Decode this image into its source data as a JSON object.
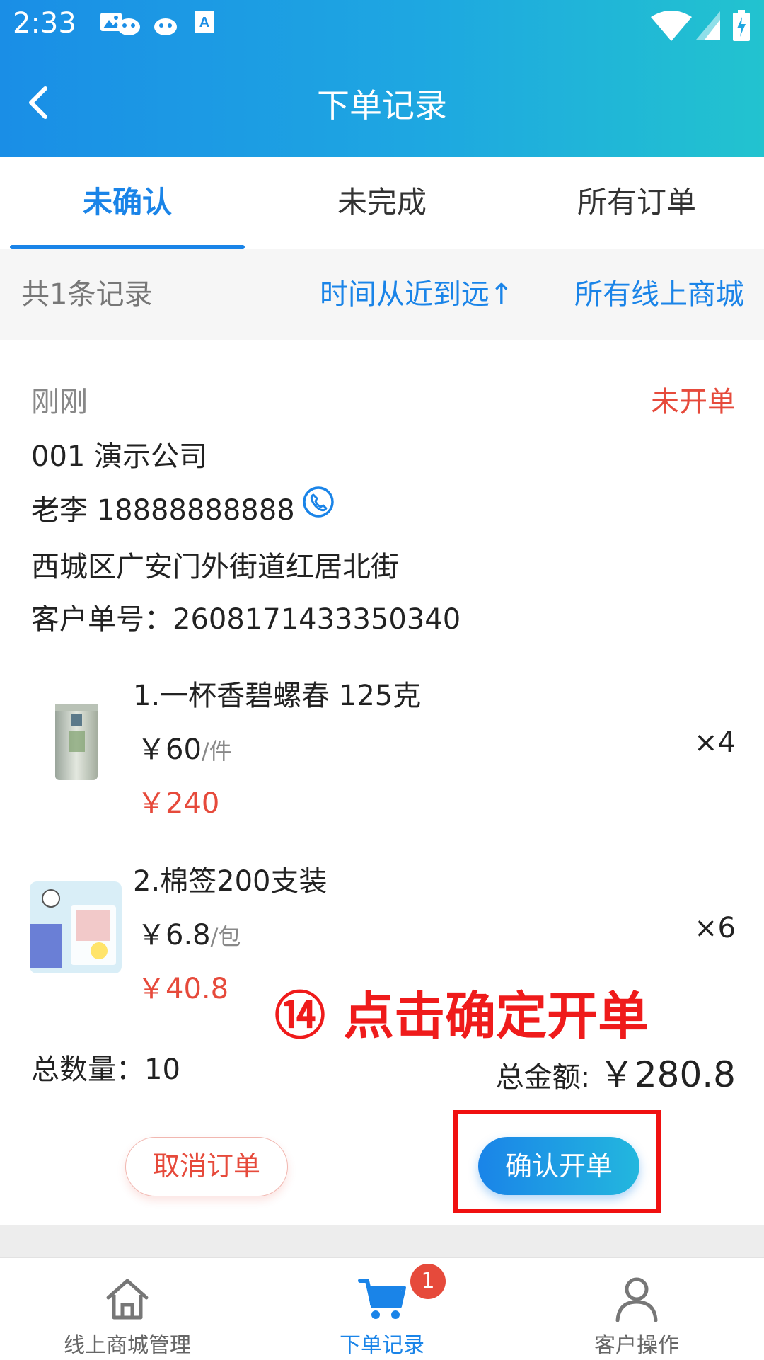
{
  "status_bar": {
    "time": "2:33"
  },
  "header": {
    "title": "下单记录"
  },
  "tabs": [
    {
      "label": "未确认",
      "active": true
    },
    {
      "label": "未完成",
      "active": false
    },
    {
      "label": "所有订单",
      "active": false
    }
  ],
  "filter_bar": {
    "record_count": "共1条记录",
    "sort": "时间从近到远↑",
    "shop_filter": "所有线上商城"
  },
  "order": {
    "time": "刚刚",
    "status": "未开单",
    "company": "001 演示公司",
    "contact": "老李 18888888888",
    "address": "西城区广安门外街道红居北街",
    "customer_no": "客户单号：2608171433350340",
    "items": [
      {
        "name": "1.一杯香碧螺春 125克",
        "price": "￥60",
        "unit": "/件",
        "qty": "×4",
        "subtotal": "￥240"
      },
      {
        "name": "2.棉签200支装",
        "price": "￥6.8",
        "unit": "/包",
        "qty": "×6",
        "subtotal": "￥40.8"
      }
    ],
    "total_qty": "总数量：10",
    "total_amount_label": "总金额:",
    "total_amount": "￥280.8",
    "cancel_label": "取消订单",
    "confirm_label": "确认开单"
  },
  "annotation": "⑭ 点击确定开单",
  "bottom_nav": [
    {
      "label": "线上商城管理",
      "icon": "home-icon",
      "active": false
    },
    {
      "label": "下单记录",
      "icon": "cart-icon",
      "active": true,
      "badge": "1"
    },
    {
      "label": "客户操作",
      "icon": "person-icon",
      "active": false
    }
  ],
  "colors": {
    "accent": "#1a84e8",
    "danger": "#e64a3b",
    "annotation": "#ef1b1b",
    "header_gradient": [
      "#1a8ee6",
      "#22c3cf"
    ]
  }
}
